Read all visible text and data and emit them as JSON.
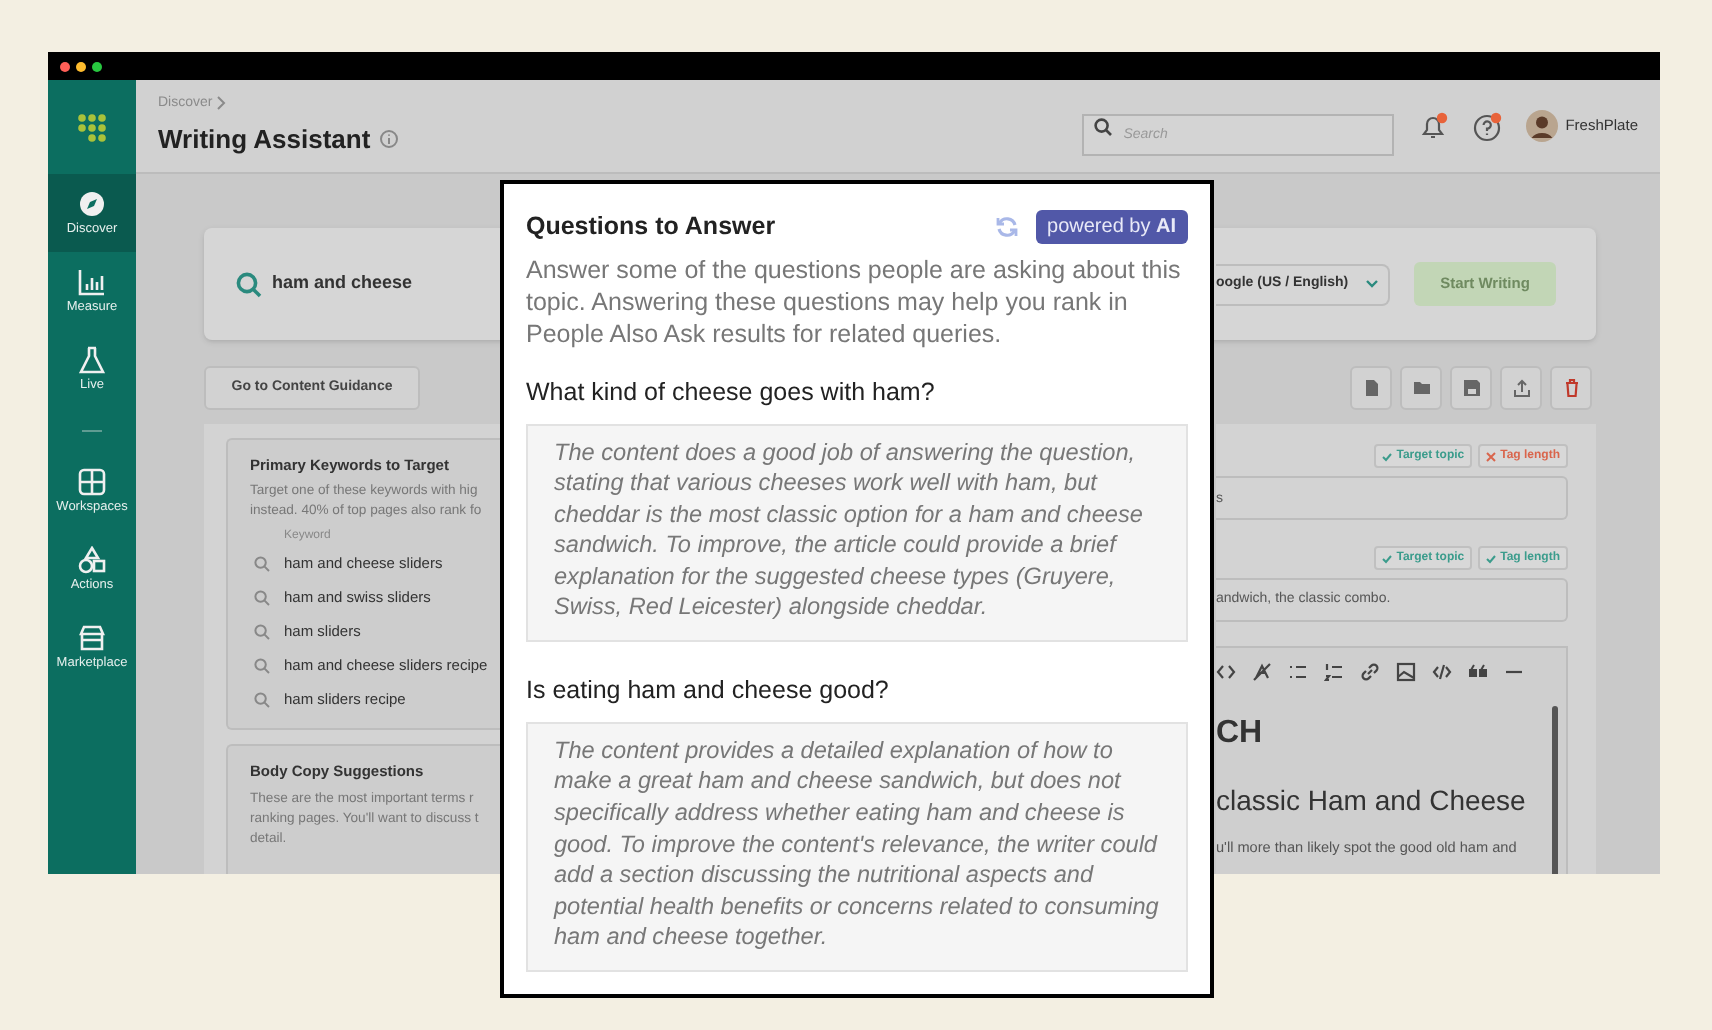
{
  "sidebar": {
    "items": [
      {
        "kind": "link",
        "label": "Discover",
        "selected": true
      },
      {
        "kind": "link",
        "label": "Measure",
        "selected": false
      },
      {
        "kind": "link",
        "label": "Live",
        "selected": false
      },
      {
        "kind": "divider"
      },
      {
        "kind": "link",
        "label": "Workspaces",
        "selected": false
      },
      {
        "kind": "link",
        "label": "Actions",
        "selected": false
      },
      {
        "kind": "link",
        "label": "Marketplace",
        "selected": false
      }
    ]
  },
  "header": {
    "breadcrumb": "Discover",
    "title": "Writing Assistant",
    "search": {
      "placeholder": "Search"
    },
    "notifications_unread": true,
    "help_unread": true,
    "user": "FreshPlate"
  },
  "query_bar": {
    "query": "ham and cheese",
    "engine": "oogle (US / English)",
    "start_button": "Start Writing",
    "start_disabled": true
  },
  "guidance_button": "Go to Content Guidance",
  "primary_keywords": {
    "title": "Primary Keywords to Target",
    "description_lines": [
      "Target one of these keywords with hig",
      "instead. 40% of top pages also rank fo"
    ],
    "column": "Keyword",
    "keywords": [
      "ham and cheese sliders",
      "ham and swiss sliders",
      "ham sliders",
      "ham and cheese sliders recipe",
      "ham sliders recipe"
    ]
  },
  "body_copy": {
    "title": "Body Copy Suggestions",
    "description_lines": [
      "These are the most important terms r",
      "ranking pages. You'll want to discuss t",
      "detail."
    ]
  },
  "editor": {
    "title_tags": [
      {
        "label": "Target topic",
        "passed": true
      },
      {
        "label": "Tag length",
        "passed": false
      }
    ],
    "title_value": "s",
    "description_tags": [
      {
        "label": "Target topic",
        "passed": true
      },
      {
        "label": "Tag length",
        "passed": true
      }
    ],
    "description_value": "andwich, the classic combo.",
    "content": [
      {
        "kind": "h1",
        "text": "CH"
      },
      {
        "kind": "h2",
        "text": "classic Ham and Cheese"
      },
      {
        "kind": "p",
        "text": "u'll more than likely spot the good old ham and"
      }
    ]
  },
  "questions_panel": {
    "title": "Questions to Answer",
    "badge": "powered by **AI**",
    "description": "Answer some of the questions people are asking about this topic. Answering these questions may help you rank in People Also Ask results for related queries.",
    "questions": [
      {
        "question": "What kind of cheese goes with ham?",
        "answer": "The content does a good job of answering the question, stating that various cheeses work well with ham, but cheddar is the most classic option for a ham and cheese sandwich. To improve, the article could provide a brief explanation for the suggested cheese types (Gruyere, Swiss, Red Leicester) alongside cheddar."
      },
      {
        "question": "Is eating ham and cheese good?",
        "answer": "The content provides a detailed explanation of how to make a great ham and cheese sandwich, but does not specifically address whether eating ham and cheese is good. To improve the content's relevance, the writer could add a section discussing the nutritional aspects and potential health benefits or concerns related to consuming ham and cheese together."
      }
    ]
  }
}
